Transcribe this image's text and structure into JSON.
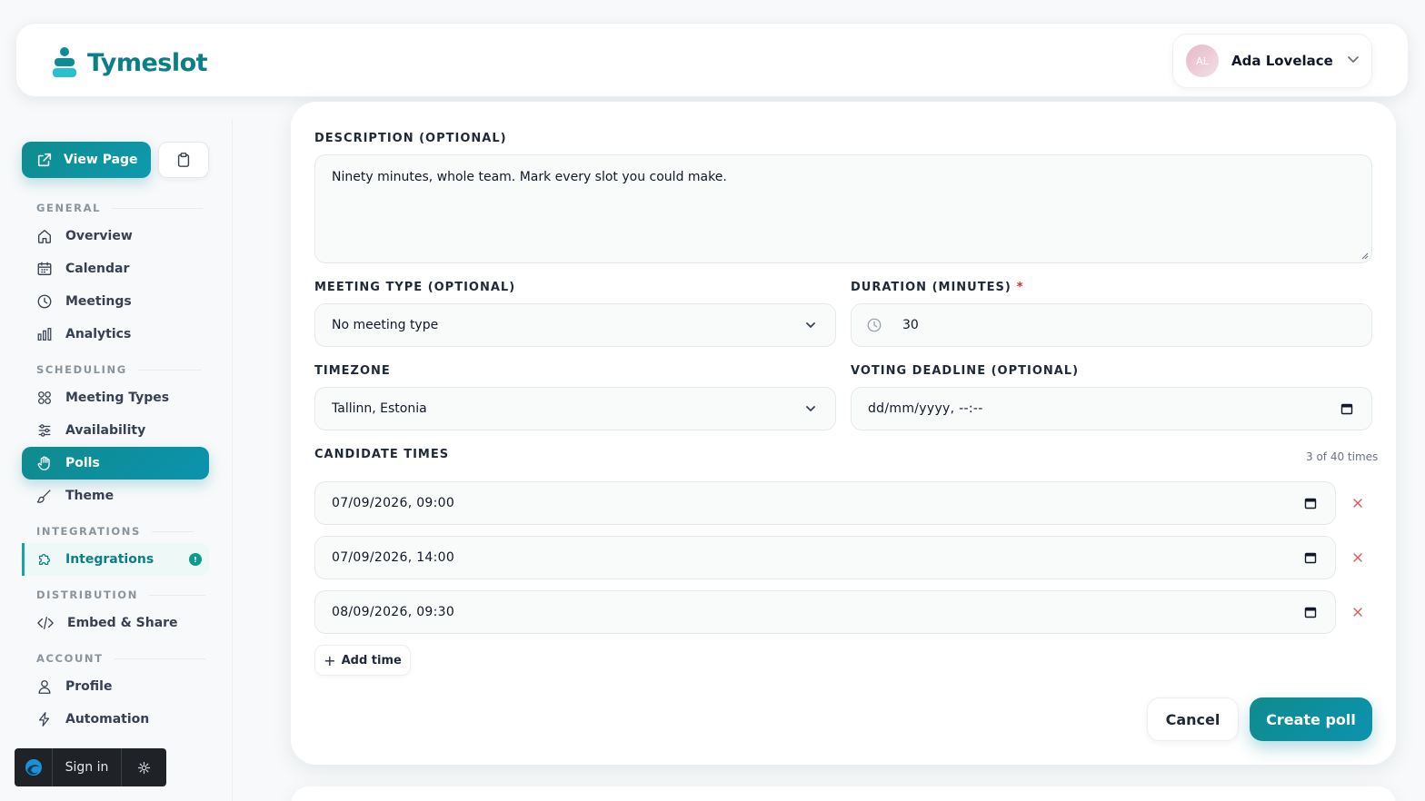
{
  "app": {
    "name": "Tymeslot"
  },
  "user": {
    "initials": "AL",
    "name": "Ada Lovelace"
  },
  "sidebar": {
    "view_page": "View Page",
    "sections": {
      "general": "GENERAL",
      "scheduling": "SCHEDULING",
      "integrations": "INTEGRATIONS",
      "distribution": "DISTRIBUTION",
      "account": "ACCOUNT"
    },
    "items": {
      "overview": "Overview",
      "calendar": "Calendar",
      "meetings": "Meetings",
      "analytics": "Analytics",
      "meeting_types": "Meeting Types",
      "availability": "Availability",
      "polls": "Polls",
      "theme": "Theme",
      "integrations": "Integrations",
      "integrations_badge": "!",
      "embed_share": "Embed & Share",
      "profile": "Profile",
      "automation": "Automation"
    },
    "signin": "Sign in"
  },
  "form": {
    "description_label": "DESCRIPTION (OPTIONAL)",
    "description_value": "Ninety minutes, whole team. Mark every slot you could make.",
    "meeting_type_label": "MEETING TYPE (OPTIONAL)",
    "meeting_type_value": "No meeting type",
    "duration_label": "DURATION (MINUTES)",
    "duration_required": "*",
    "duration_value": "30",
    "timezone_label": "TIMEZONE",
    "timezone_value": "Tallinn, Estonia",
    "deadline_label": "VOTING DEADLINE (OPTIONAL)",
    "deadline_placeholder": "dd/mm/yyyy, --:--",
    "candidates_label": "CANDIDATE TIMES",
    "candidates_count": "3 of 40 times",
    "candidates": [
      "07/09/2026, 09:00",
      "07/09/2026, 14:00",
      "08/09/2026, 09:30"
    ],
    "add_time": "Add time",
    "cancel": "Cancel",
    "create": "Create poll"
  },
  "colors": {
    "accent": "#0f8b8d",
    "accent_light": "#29c0d0",
    "danger": "#dc2626"
  }
}
